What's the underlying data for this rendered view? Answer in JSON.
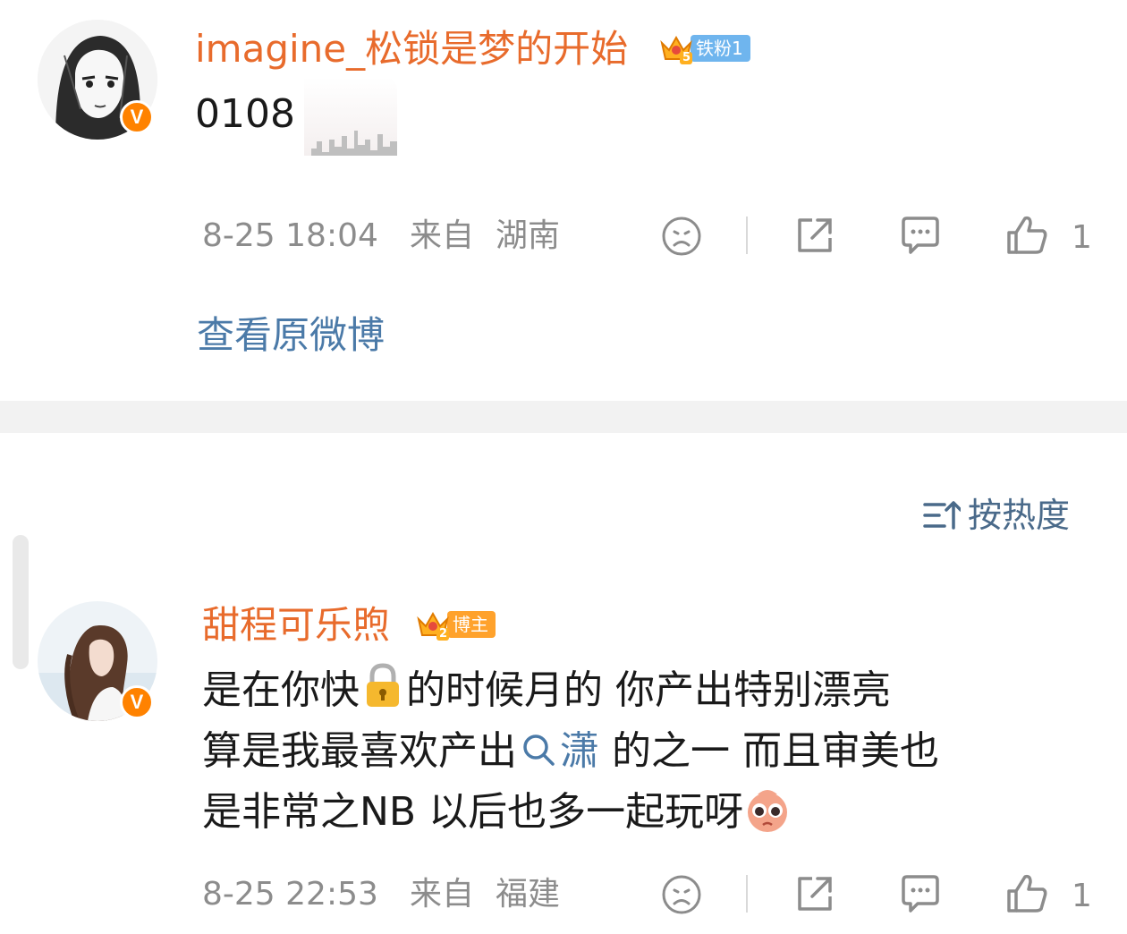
{
  "comments": [
    {
      "username": "imagine_松锁是梦的开始",
      "badge": {
        "level": "5",
        "label": "铁粉1",
        "color": "#6fb5ee"
      },
      "text_lines": [
        "0108"
      ],
      "meta": {
        "date": "8-25 18:04",
        "source_label": "来自",
        "location": "湖南"
      },
      "likes": "1"
    },
    {
      "username": "甜程可乐煦",
      "badge": {
        "level": "2",
        "label": "博主",
        "color": "#ffa22c"
      },
      "text_line1_a": "是在你快",
      "text_line1_b": "的时候月的 你产出特别漂亮",
      "text_line2_a": "算是我最喜欢产出",
      "text_line2_link": "潇",
      "text_line2_b": " 的之一 而且审美也",
      "text_line3": "是非常之NB 以后也多一起玩呀",
      "meta": {
        "date": "8-25 22:53",
        "source_label": "来自",
        "location": "福建"
      },
      "likes": "1"
    }
  ],
  "view_original": "查看原微博",
  "sort_label": "按热度",
  "colors": {
    "username": "#e86b2c",
    "link": "#4b7aa8",
    "meta": "#8c8c8c",
    "verified": "#ff8200"
  },
  "icons": [
    "sad-face-icon",
    "share-icon",
    "comment-icon",
    "thumbs-up-icon",
    "sort-icon",
    "lock-emoji-icon",
    "search-icon",
    "crying-emoji-icon",
    "crown-icon",
    "verified-icon"
  ]
}
